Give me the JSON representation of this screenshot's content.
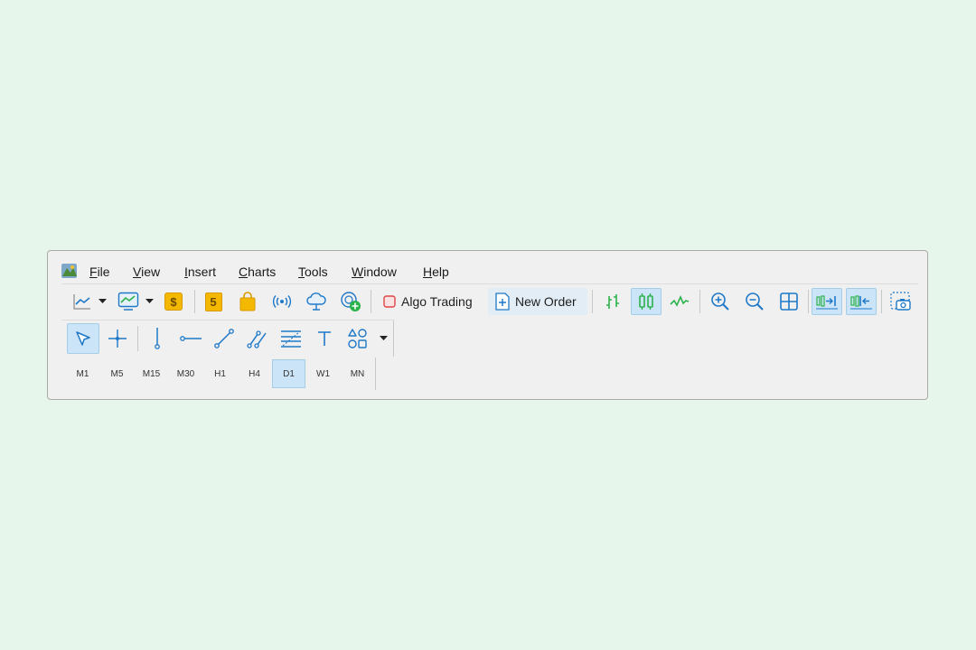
{
  "menu": {
    "items": [
      {
        "key": "F",
        "rest": "ile"
      },
      {
        "key": "V",
        "rest": "iew"
      },
      {
        "key": "I",
        "rest": "nsert"
      },
      {
        "key": "C",
        "rest": "harts"
      },
      {
        "key": "T",
        "rest": "ools"
      },
      {
        "key": "W",
        "rest": "indow"
      },
      {
        "key": "H",
        "rest": "elp"
      }
    ]
  },
  "toolbar": {
    "algo_trading_label": "Algo Trading",
    "new_order_label": "New Order",
    "book_icon_text": "5",
    "dollar_icon_text": "$",
    "bar_chart_active": false,
    "candlestick_active": true,
    "autoscroll_active": true,
    "chart_shift_active": true
  },
  "drawing_toolbar": {
    "cursor_active": true
  },
  "timeframes": {
    "items": [
      "M1",
      "M5",
      "M15",
      "M30",
      "H1",
      "H4",
      "D1",
      "W1",
      "MN"
    ],
    "selected": "D1"
  },
  "colors": {
    "accent": "#1e78c8",
    "green": "#2bb34b",
    "active_bg": "#cce4f7"
  }
}
